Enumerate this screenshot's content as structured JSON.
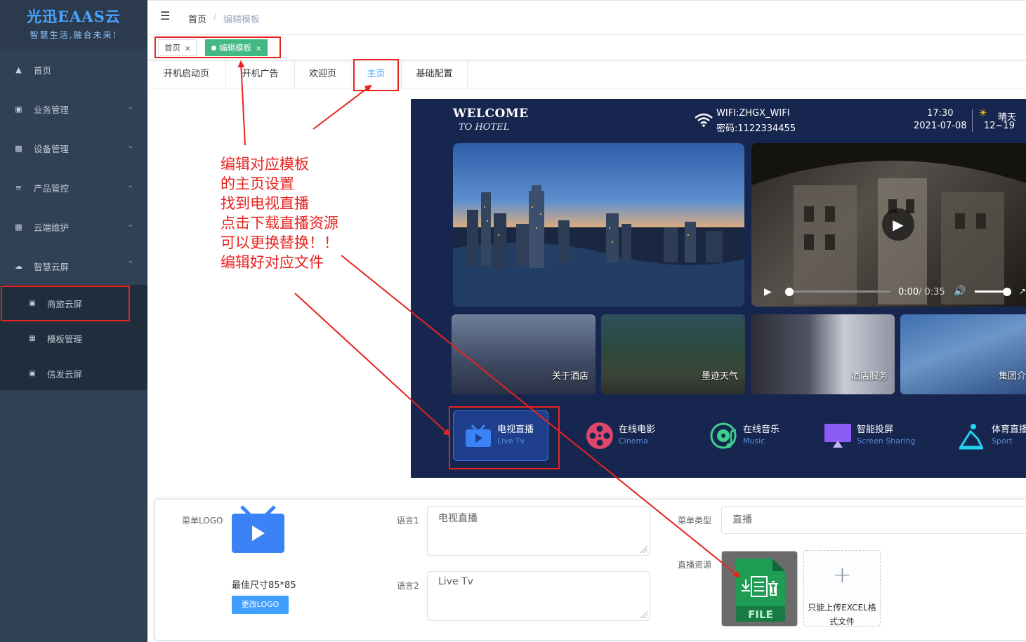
{
  "sidebar": {
    "logo_title": "光迅EAAS云",
    "logo_slogan": "智慧生活,融合未来!",
    "items": [
      {
        "label": "首页",
        "icon": "home-icon"
      },
      {
        "label": "业务管理",
        "icon": "business-icon"
      },
      {
        "label": "设备管理",
        "icon": "device-icon"
      },
      {
        "label": "产品管控",
        "icon": "product-icon"
      },
      {
        "label": "云端维护",
        "icon": "grid-icon"
      },
      {
        "label": "智慧云屏",
        "icon": "cloud-icon"
      }
    ],
    "subitems": [
      {
        "label": "商旅云屏",
        "icon": "screen-icon"
      },
      {
        "label": "模板管理",
        "icon": "template-icon"
      },
      {
        "label": "信发云屏",
        "icon": "publish-icon"
      }
    ]
  },
  "header": {
    "breadcrumb_home": "首页",
    "breadcrumb_sep": "/",
    "breadcrumb_current": "编辑模板"
  },
  "tags": [
    {
      "label": "首页",
      "close": "×"
    },
    {
      "label": "编辑模板",
      "close": "×"
    }
  ],
  "page_tabs": [
    "开机启动页",
    "开机广告",
    "欢迎页",
    "主页",
    "基础配置"
  ],
  "annotation": {
    "lines": [
      "编辑对应模板",
      "的主页设置",
      "找到电视直播",
      "点击下载直播资源",
      "可以更换替换！！",
      "编辑好对应文件"
    ]
  },
  "preview": {
    "welcome": "WELCOME",
    "to_hotel": "TO HOTEL",
    "wifi_name": "WIFI:ZHGX_WIFI",
    "wifi_password": "密码:1122334455",
    "time": "17:30",
    "date": "2021-07-08",
    "weather": "晴天",
    "temperature": "12~19",
    "video": {
      "current": "0:00",
      "duration": "/ 0:35",
      "progress": 0
    },
    "cards": [
      "关于酒店",
      "墨迹天气",
      "酒店服务",
      "集团介"
    ],
    "menu": [
      {
        "zh": "电视直播",
        "en": "Live Tv",
        "icon": "tv-icon"
      },
      {
        "zh": "在线电影",
        "en": "Cinema",
        "icon": "film-reel-icon"
      },
      {
        "zh": "在线音乐",
        "en": "Music",
        "icon": "music-disc-icon"
      },
      {
        "zh": "智能投屏",
        "en": "Screen Sharing",
        "icon": "screen-cast-icon"
      },
      {
        "zh": "体育直播",
        "en": "Sport",
        "icon": "sport-icon"
      }
    ]
  },
  "form": {
    "logo_label": "菜单LOGO",
    "size_tip": "最佳尺寸85*85",
    "change_logo": "更改LOGO",
    "lang1_label": "语言1",
    "lang1_value": "电视直播",
    "lang2_label": "语言2",
    "lang2_value": "Live Tv",
    "type_label": "菜单类型",
    "type_value": "直播",
    "resource_label": "直播资源",
    "file_label": "FILE",
    "upload_tip": "只能上传EXCEL格式文件"
  },
  "colors": {
    "sidebar_bg": "#304156",
    "accent": "#409eff",
    "tag_active": "#42b983",
    "annotation_red": "#e8231e",
    "preview_bg": "#17264f"
  }
}
